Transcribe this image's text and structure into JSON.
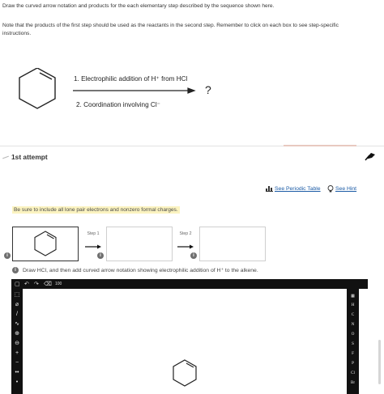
{
  "prompt": {
    "line1": "Draw the curved arrow notation and products for the each elementary step described by the sequence shown here.",
    "line2": "Note that the products of the first step should be used as the reactants in the second step. Remember to click on each box to see step-specific instructions."
  },
  "reaction": {
    "step1": "1. Electrophilic addition of H⁺ from HCl",
    "step2": "2. Coordination involving Cl⁻",
    "product": "?"
  },
  "attempt": {
    "label": "1st attempt"
  },
  "tools": {
    "periodic_table": "See Periodic Table",
    "hint": "See Hint"
  },
  "note": "Be sure to include all lone pair electrons and nonzero formal charges.",
  "steps": {
    "step1": "Step 1",
    "step2": "Step 2"
  },
  "instruction": "Draw HCl, and then add curved arrow notation showing electrophilic addition of H⁺ to the alkene.",
  "editor": {
    "top_labels": {
      "scale": "100"
    },
    "left_tools": {
      "charge_plus": "⊕",
      "charge_minus": "⊖",
      "plus": "+",
      "minus": "−"
    },
    "elements": [
      "H",
      "C",
      "N",
      "O",
      "S",
      "F",
      "P",
      "Cl",
      "Br"
    ]
  },
  "colors": {
    "link": "#1a5aa5",
    "note_bg": "#fbf3c0",
    "toolbar": "#111111"
  },
  "icons": [
    "bar-chart-icon",
    "lightbulb-icon",
    "info-icon",
    "undo-icon",
    "redo-icon",
    "flag-icon"
  ]
}
